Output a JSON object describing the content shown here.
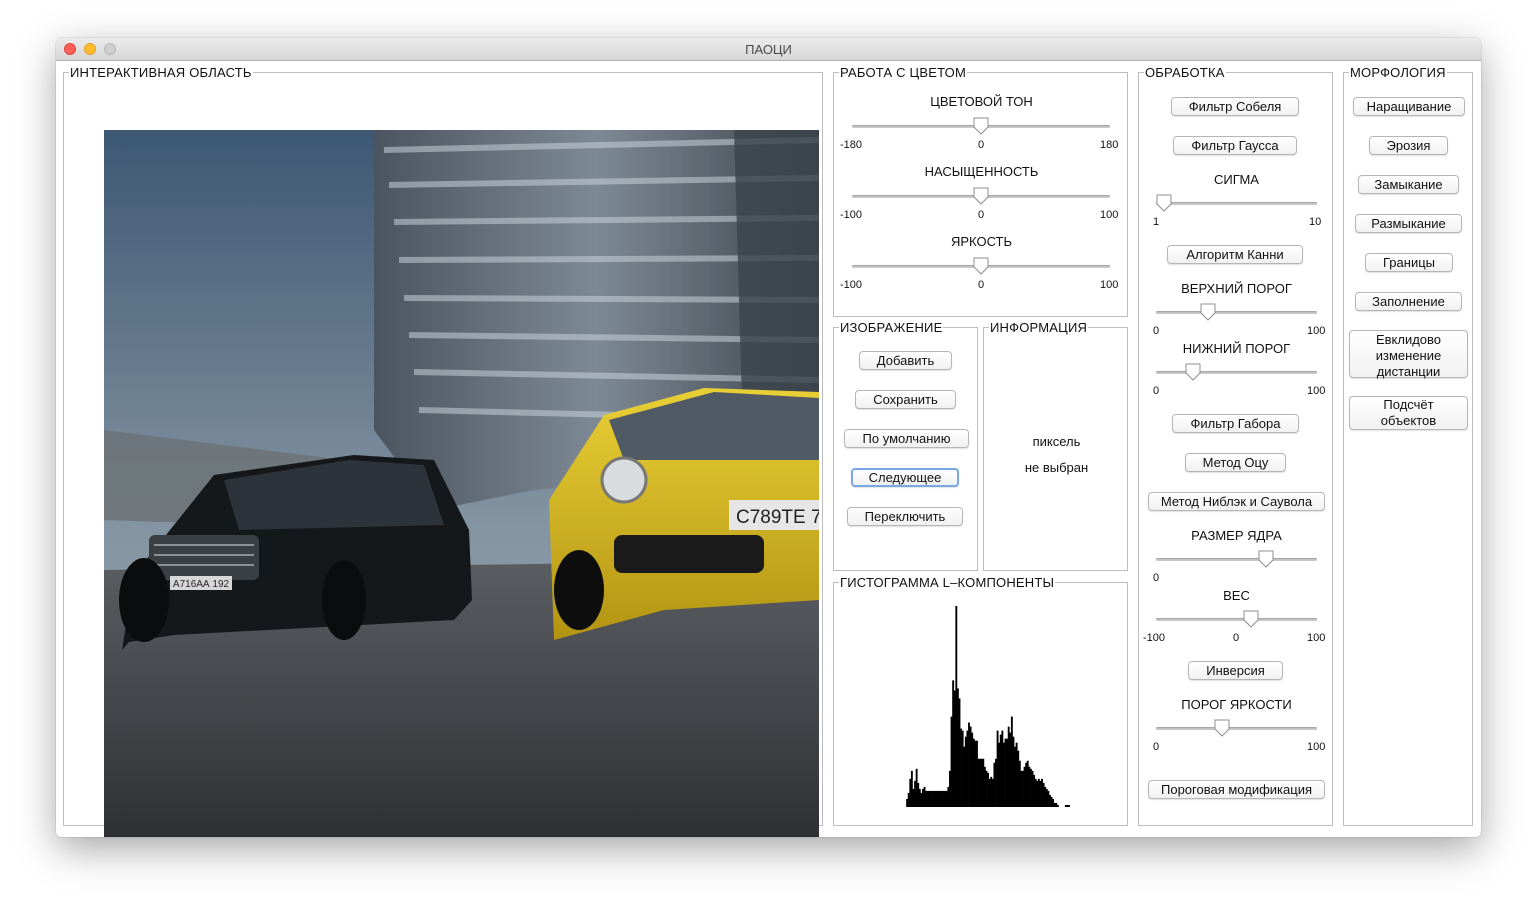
{
  "window": {
    "title": "ПАОЦИ"
  },
  "panels": {
    "interactive": "ИНТЕРАКТИВНАЯ ОБЛАСТЬ",
    "color": "РАБОТА С ЦВЕТОМ",
    "image": "ИЗОБРАЖЕНИЕ",
    "info": "ИНФОРМАЦИЯ",
    "histogram": "ГИСТОГРАММА L–КОМПОНЕНТЫ",
    "processing": "ОБРАБОТКА",
    "morphology": "МОРФОЛОГИЯ"
  },
  "photo": {
    "plate_left": "А716АА 192",
    "plate_right": "С789ТЕ 7"
  },
  "color": {
    "hue": {
      "label": "ЦВЕТОВОЙ ТОН",
      "min": "-180",
      "mid": "0",
      "max": "180",
      "value": 0,
      "range": [
        -180,
        180
      ]
    },
    "saturation": {
      "label": "НАСЫЩЕННОСТЬ",
      "min": "-100",
      "mid": "0",
      "max": "100",
      "value": 0,
      "range": [
        -100,
        100
      ]
    },
    "brightness": {
      "label": "ЯРКОСТЬ",
      "min": "-100",
      "mid": "0",
      "max": "100",
      "value": 0,
      "range": [
        -100,
        100
      ]
    }
  },
  "image_buttons": {
    "add": "Добавить",
    "save": "Сохранить",
    "default": "По умолчанию",
    "next": "Следующее",
    "switch": "Переключить"
  },
  "info": {
    "line1": "пиксель",
    "line2": "не выбран"
  },
  "histogram_values": [
    0,
    0,
    0,
    0,
    0,
    0,
    0,
    0,
    0,
    0,
    0,
    0,
    0,
    0,
    0,
    0,
    0,
    0,
    0,
    4,
    7,
    14,
    18,
    9,
    13,
    19,
    12,
    9,
    7,
    9,
    10,
    8,
    8,
    8,
    8,
    8,
    8,
    8,
    8,
    8,
    8,
    8,
    8,
    8,
    8,
    10,
    18,
    45,
    63,
    58,
    100,
    59,
    54,
    39,
    38,
    30,
    35,
    38,
    42,
    40,
    37,
    34,
    33,
    33,
    24,
    24,
    24,
    24,
    20,
    18,
    17,
    14,
    15,
    14,
    22,
    24,
    38,
    32,
    36,
    38,
    32,
    34,
    34,
    40,
    37,
    45,
    35,
    30,
    32,
    28,
    23,
    18,
    18,
    20,
    22,
    23,
    20,
    19,
    18,
    16,
    14,
    13,
    14,
    13,
    14,
    12,
    10,
    9,
    8,
    6,
    5,
    4,
    2,
    2,
    1,
    0,
    0,
    0,
    0,
    1,
    1,
    1,
    0,
    0,
    0,
    0
  ],
  "processing": {
    "sobel": "Фильтр Собеля",
    "gauss": "Фильтр Гаусса",
    "sigma": {
      "label": "СИГМА",
      "min": "1",
      "max": "10",
      "value": 1,
      "range": [
        1,
        10
      ]
    },
    "canny": "Алгоритм Канни",
    "upper": {
      "label": "ВЕРХНИЙ ПОРОГ",
      "min": "0",
      "max": "100",
      "value": 30,
      "range": [
        0,
        100
      ]
    },
    "lower": {
      "label": "НИЖНИЙ ПОРОГ",
      "min": "0",
      "max": "100",
      "value": 20,
      "range": [
        0,
        100
      ]
    },
    "gabor": "Фильтр Габора",
    "otsu": "Метод Оцу",
    "niblack": "Метод Ниблэк и Саувола",
    "kernel": {
      "label": "РАЗМЕР ЯДРА",
      "min": "0",
      "value": 70,
      "range": [
        0,
        100
      ]
    },
    "weight": {
      "label": "ВЕС",
      "min": "-100",
      "mid": "0",
      "max": "100",
      "value": 20,
      "range": [
        -100,
        100
      ]
    },
    "inversion": "Инверсия",
    "brightness_threshold": {
      "label": "ПОРОГ ЯРКОСТИ",
      "min": "0",
      "max": "100",
      "value": 40,
      "range": [
        0,
        100
      ]
    },
    "threshold_mod": "Пороговая модификация"
  },
  "morphology": {
    "dilate": "Наращивание",
    "erode": "Эрозия",
    "close": "Замыкание",
    "open": "Размыкание",
    "borders": "Границы",
    "fill": "Заполнение",
    "euclid": [
      "Евклидово",
      "изменение",
      "дистанции"
    ],
    "count": [
      "Подсчёт",
      "объектов"
    ]
  }
}
